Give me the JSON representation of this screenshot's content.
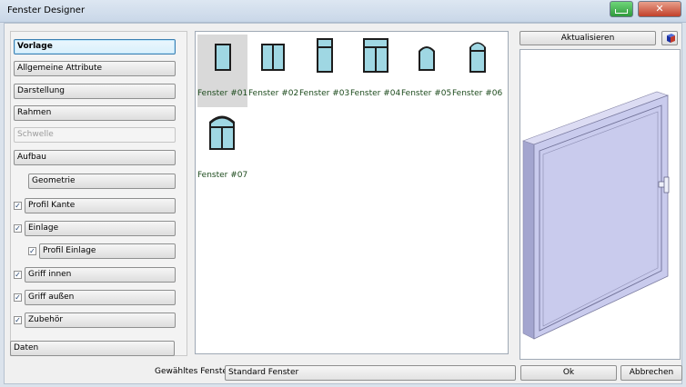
{
  "window": {
    "title": "Fenster Designer"
  },
  "titlebar": {
    "close_label": "✕"
  },
  "sidebar": {
    "items": [
      {
        "label": "Vorlage"
      },
      {
        "label": "Allgemeine Attribute"
      },
      {
        "label": "Darstellung"
      },
      {
        "label": "Rahmen"
      },
      {
        "label": "Schwelle",
        "disabled": true
      },
      {
        "label": "Aufbau"
      },
      {
        "label": "Geometrie"
      },
      {
        "label": "Profil Kante",
        "checked": true
      },
      {
        "label": "Einlage",
        "checked": true
      },
      {
        "label": "Profil Einlage",
        "checked": true
      },
      {
        "label": "Griff innen",
        "checked": true
      },
      {
        "label": "Griff außen",
        "checked": true
      },
      {
        "label": "Zubehör",
        "checked": true
      }
    ],
    "check_mark": "✓",
    "daten_label": "Daten"
  },
  "templates": {
    "selected": "Fenster #01",
    "items": [
      {
        "label": "Fenster #01",
        "shape": "single"
      },
      {
        "label": "Fenster #02",
        "shape": "double"
      },
      {
        "label": "Fenster #03",
        "shape": "transom"
      },
      {
        "label": "Fenster #04",
        "shape": "transom-double"
      },
      {
        "label": "Fenster #05",
        "shape": "arch"
      },
      {
        "label": "Fenster #06",
        "shape": "arch-transom"
      },
      {
        "label": "Fenster #07",
        "shape": "arch-double"
      }
    ]
  },
  "preview": {
    "refresh_label": "Aktualisieren",
    "view_icon": "cube-icon",
    "window_color": "#c9cbed"
  },
  "footer": {
    "selected_label": "Gewähltes Fenster",
    "selected_value": "Standard Fenster",
    "ok_label": "Ok",
    "cancel_label": "Abbrechen"
  }
}
